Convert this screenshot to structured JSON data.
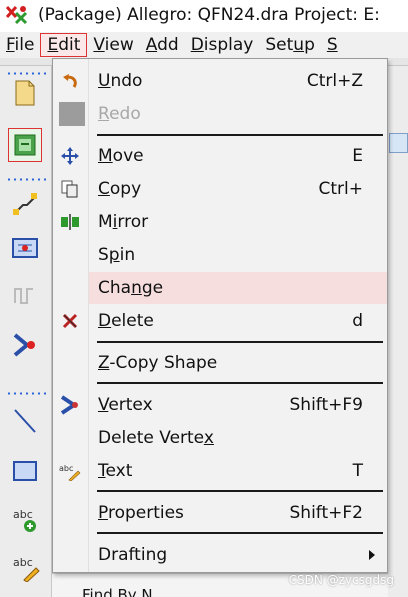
{
  "window": {
    "title": "(Package) Allegro: QFN24.dra  Project: E:"
  },
  "menubar": {
    "items": [
      {
        "label": "File",
        "mnemonic": "F",
        "rest": "ile"
      },
      {
        "label": "Edit",
        "mnemonic": "E",
        "rest": "dit"
      },
      {
        "label": "View",
        "mnemonic": "V",
        "rest": "iew"
      },
      {
        "label": "Add",
        "mnemonic": "A",
        "rest": "dd"
      },
      {
        "label": "Display",
        "mnemonic": "D",
        "rest": "isplay"
      },
      {
        "label": "Setup",
        "pre": "Set",
        "mnemonic": "u",
        "rest": "p"
      },
      {
        "label": "S",
        "mnemonic": "S",
        "rest": ""
      }
    ],
    "active": "Edit"
  },
  "edit_menu": {
    "items": [
      {
        "id": "undo",
        "pre": "",
        "mnemonic": "U",
        "post": "ndo",
        "shortcut": "Ctrl+Z",
        "icon": "undo-icon"
      },
      {
        "id": "redo",
        "pre": "",
        "mnemonic": "R",
        "post": "edo",
        "shortcut": "",
        "icon": "redo-icon",
        "disabled": true
      },
      {
        "id": "move",
        "pre": "",
        "mnemonic": "M",
        "post": "ove",
        "shortcut": "E",
        "icon": "move-icon"
      },
      {
        "id": "copy",
        "pre": "",
        "mnemonic": "C",
        "post": "opy",
        "shortcut": "Ctrl+",
        "icon": "copy-icon"
      },
      {
        "id": "mirror",
        "pre": "M",
        "mnemonic": "i",
        "post": "rror",
        "shortcut": "",
        "icon": "mirror-icon"
      },
      {
        "id": "spin",
        "pre": "S",
        "mnemonic": "p",
        "post": "in",
        "shortcut": "",
        "icon": ""
      },
      {
        "id": "change",
        "pre": "Cha",
        "mnemonic": "n",
        "post": "ge",
        "shortcut": "",
        "icon": "",
        "highlighted": true
      },
      {
        "id": "delete",
        "pre": "",
        "mnemonic": "D",
        "post": "elete",
        "shortcut": "d",
        "icon": "delete-icon"
      },
      {
        "id": "z-copy-shape",
        "pre": "",
        "mnemonic": "Z",
        "post": "-Copy Shape",
        "shortcut": "",
        "icon": ""
      },
      {
        "id": "vertex",
        "pre": "",
        "mnemonic": "V",
        "post": "ertex",
        "shortcut": "Shift+F9",
        "icon": "vertex-icon"
      },
      {
        "id": "delete-vertex",
        "pre": "Delete Verte",
        "mnemonic": "x",
        "post": "",
        "shortcut": "",
        "icon": ""
      },
      {
        "id": "text",
        "pre": "",
        "mnemonic": "T",
        "post": "ext",
        "shortcut": "T",
        "icon": "text-edit-icon"
      },
      {
        "id": "properties",
        "pre": "",
        "mnemonic": "P",
        "post": "roperties",
        "shortcut": "Shift+F2",
        "icon": ""
      },
      {
        "id": "drafting",
        "pre": "Drafting",
        "mnemonic": "",
        "post": "",
        "shortcut": "",
        "icon": "",
        "submenu": true
      }
    ]
  },
  "background": {
    "partial_text": "Find By N"
  },
  "watermark": "CSDN @zycsgdsg",
  "colors": {
    "highlight": "#f7dede",
    "active_menu_border": "#dd3333",
    "toolbar_dots": "#2a64d6"
  }
}
